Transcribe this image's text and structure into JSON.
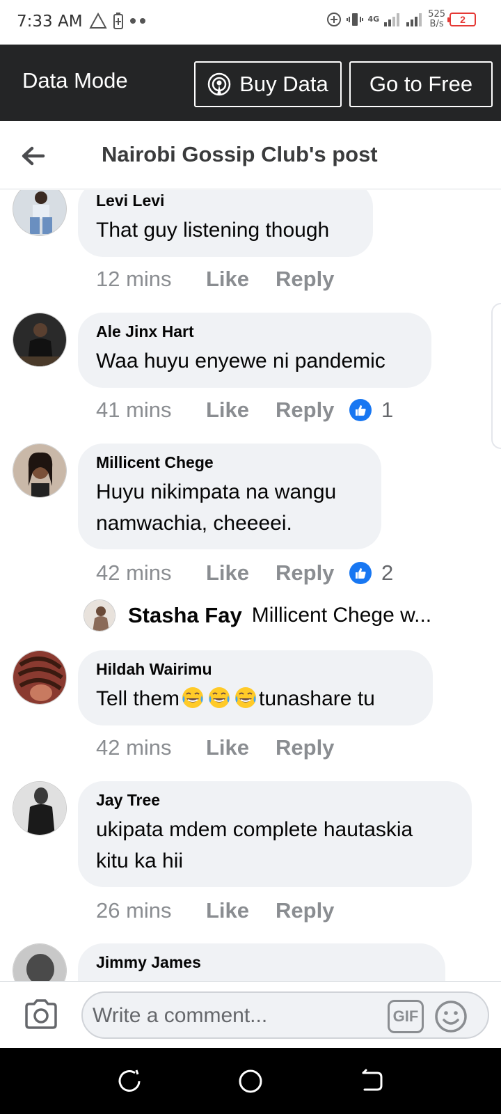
{
  "status_bar": {
    "time": "7:33 AM",
    "network": "4G",
    "speed_value": "525",
    "speed_unit": "B/s",
    "battery": "2",
    "battery_color": "#e53935"
  },
  "data_bar": {
    "title": "Data Mode",
    "buy_label": "Buy Data",
    "free_label": "Go to Free",
    "background": "#242526"
  },
  "header": {
    "title": "Nairobi Gossip Club's post",
    "back_icon": "arrow-left-icon"
  },
  "comments": [
    {
      "author": "Levi Levi",
      "text": "That guy listening though",
      "time": "12 mins",
      "like": "Like",
      "reply": "Reply",
      "reactions": ""
    },
    {
      "author": "Ale Jinx Hart",
      "text": "Waa huyu enyewe ni pandemic",
      "time": "41 mins",
      "like": "Like",
      "reply": "Reply",
      "reactions": "1"
    },
    {
      "author": "Millicent Chege",
      "text_line1": "Huyu nikimpata na wangu",
      "text_line2": "namwachia,  cheeeei.",
      "time": "42 mins",
      "like": "Like",
      "reply": "Reply",
      "reactions": "2"
    },
    {
      "author": "Hildah Wairimu",
      "text_before": "Tell them",
      "text_after": "tunashare tu",
      "emoji": "face-with-tears-of-joy",
      "time": "42 mins",
      "like": "Like",
      "reply": "Reply",
      "reactions": ""
    },
    {
      "author": "Jay Tree",
      "text_line1": "ukipata mdem complete hautaskia",
      "text_line2": "kitu ka hii",
      "time": "26 mins",
      "like": "Like",
      "reply": "Reply",
      "reactions": ""
    },
    {
      "author": "Jimmy James"
    }
  ],
  "reply_preview": {
    "name": "Stasha Fay",
    "text": "Millicent Chege w..."
  },
  "composer": {
    "placeholder": "Write a comment...",
    "gif_label": "GIF"
  },
  "colors": {
    "like_blue": "#1877f2",
    "bubble": "#f0f2f5",
    "meta_gray": "#8a8d91"
  }
}
